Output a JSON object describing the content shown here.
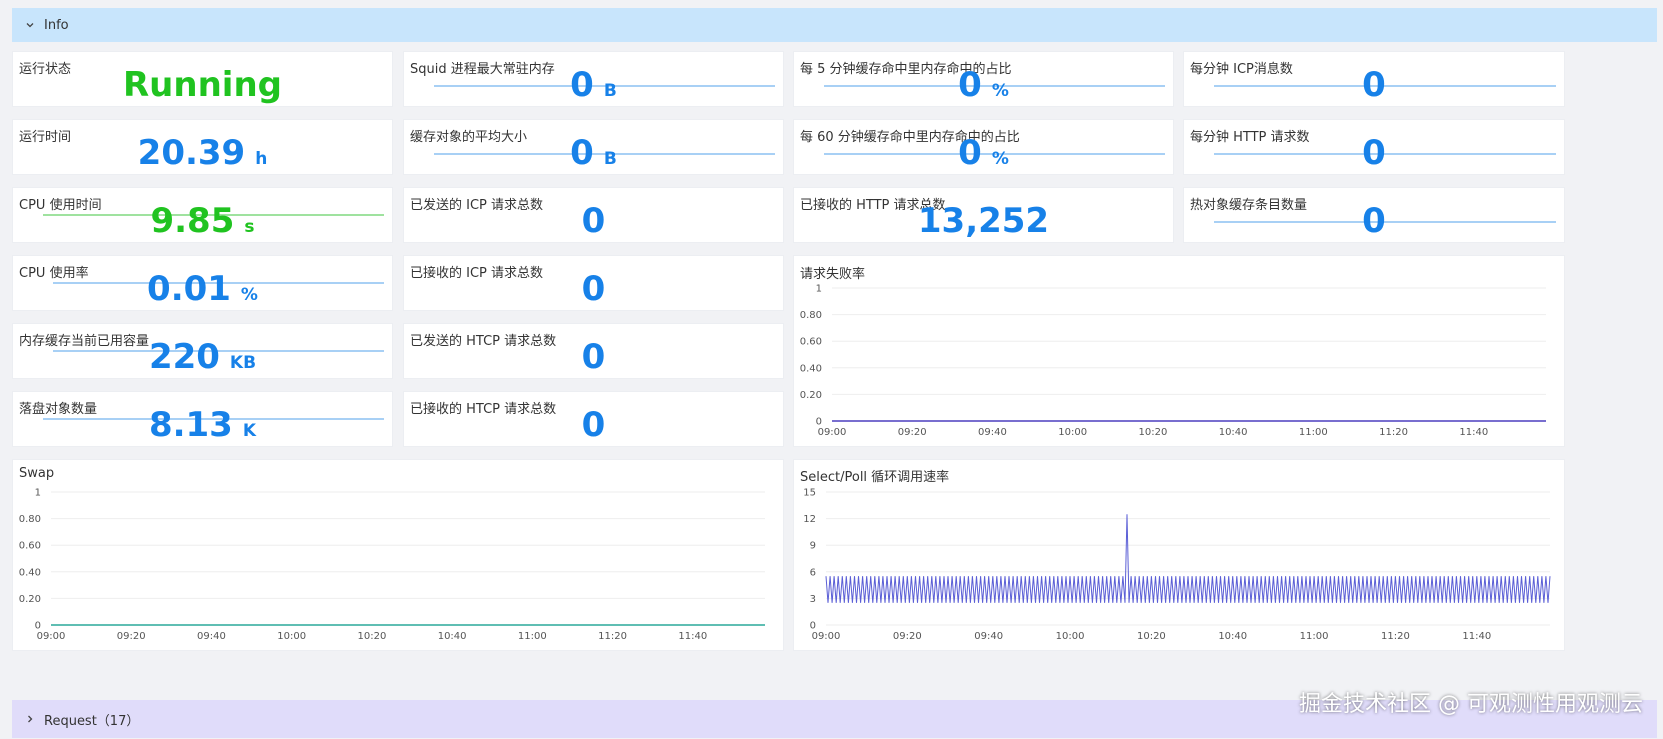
{
  "sections": {
    "info": {
      "label": "Info"
    },
    "request": {
      "label": "Request（17）"
    }
  },
  "stats": {
    "run_status": {
      "title": "运行状态",
      "value": "Running",
      "unit": ""
    },
    "uptime": {
      "title": "运行时间",
      "value": "20.39",
      "unit": "h"
    },
    "cpu_time": {
      "title": "CPU 使用时间",
      "value": "9.85",
      "unit": "s"
    },
    "cpu_usage": {
      "title": "CPU 使用率",
      "value": "0.01",
      "unit": "%"
    },
    "mem_cache_used": {
      "title": "内存缓存当前已用容量",
      "value": "220",
      "unit": "KB"
    },
    "disk_objects": {
      "title": "落盘对象数量",
      "value": "8.13",
      "unit": "K"
    },
    "squid_max_rss": {
      "title": "Squid 进程最大常驻内存",
      "value": "0",
      "unit": "B"
    },
    "avg_object_size": {
      "title": "缓存对象的平均大小",
      "value": "0",
      "unit": "B"
    },
    "icp_sent_total": {
      "title": "已发送的 ICP 请求总数",
      "value": "0",
      "unit": ""
    },
    "icp_recv_total": {
      "title": "已接收的 ICP 请求总数",
      "value": "0",
      "unit": ""
    },
    "htcp_sent_total": {
      "title": "已发送的 HTCP 请求总数",
      "value": "0",
      "unit": ""
    },
    "htcp_recv_total": {
      "title": "已接收的 HTCP 请求总数",
      "value": "0",
      "unit": ""
    },
    "hit_ratio_5m": {
      "title": "每 5 分钟缓存命中里内存命中的占比",
      "value": "0",
      "unit": "%"
    },
    "hit_ratio_60m": {
      "title": "每 60 分钟缓存命中里内存命中的占比",
      "value": "0",
      "unit": "%"
    },
    "http_recv_total": {
      "title": "已接收的 HTTP 请求总数",
      "value": "13,252",
      "unit": ""
    },
    "icp_per_min": {
      "title": "每分钟 ICP消息数",
      "value": "0",
      "unit": ""
    },
    "http_per_min": {
      "title": "每分钟 HTTP 请求数",
      "value": "0",
      "unit": ""
    },
    "hot_objects": {
      "title": "热对象缓存条目数量",
      "value": "0",
      "unit": ""
    }
  },
  "charts": {
    "failure_rate": {
      "title": "请求失败率"
    },
    "swap": {
      "title": "Swap"
    },
    "select_poll": {
      "title": "Select/Poll 循环调用速率"
    }
  },
  "chart_data": [
    {
      "id": "failure_rate",
      "type": "line",
      "title": "请求失败率",
      "x_ticks": [
        "09:00",
        "09:20",
        "09:40",
        "10:00",
        "10:20",
        "10:40",
        "11:00",
        "11:20",
        "11:40"
      ],
      "y_ticks": [
        "0",
        "0.20",
        "0.40",
        "0.60",
        "0.80",
        "1"
      ],
      "ylim": [
        0,
        1
      ],
      "xlim": [
        "09:00",
        "11:58"
      ],
      "series": [
        {
          "color": "#4b3fbf",
          "points": [
            [
              "09:00",
              0
            ],
            [
              "11:58",
              0
            ]
          ]
        }
      ]
    },
    {
      "id": "swap",
      "type": "line",
      "title": "Swap",
      "x_ticks": [
        "09:00",
        "09:20",
        "09:40",
        "10:00",
        "10:20",
        "10:40",
        "11:00",
        "11:20",
        "11:40"
      ],
      "y_ticks": [
        "0",
        "0.20",
        "0.40",
        "0.60",
        "0.80",
        "1"
      ],
      "ylim": [
        0,
        1
      ],
      "xlim": [
        "09:00",
        "11:58"
      ],
      "series": [
        {
          "color": "#2aa89a",
          "points": [
            [
              "09:00",
              0
            ],
            [
              "11:58",
              0
            ]
          ]
        }
      ]
    },
    {
      "id": "select_poll",
      "type": "line",
      "title": "Select/Poll 循环调用速率",
      "x_ticks": [
        "09:00",
        "09:20",
        "09:40",
        "10:00",
        "10:20",
        "10:40",
        "11:00",
        "11:20",
        "11:40"
      ],
      "y_ticks": [
        "0",
        "3",
        "6",
        "9",
        "12",
        "15"
      ],
      "ylim": [
        0,
        15
      ],
      "xlim": [
        "09:00",
        "11:58"
      ],
      "series": [
        {
          "color": "#5b5fd6",
          "oscillation": {
            "low": 2.5,
            "high": 5.5,
            "period_minutes": 1
          },
          "spike": {
            "time": "10:14",
            "value": 12.5
          }
        }
      ]
    }
  ],
  "colors": {
    "blue": "#1781e8",
    "green": "#20c320",
    "info_bar": "#c8e5fc",
    "request_bar": "#e0dcfa"
  },
  "icons": {
    "info_toggle": "chevron-down-icon",
    "request_toggle": "chevron-right-icon"
  },
  "watermark": "掘金技术社区 @ 可观测性用观测云"
}
